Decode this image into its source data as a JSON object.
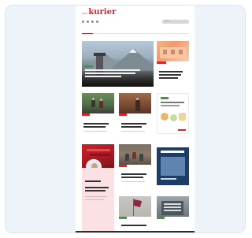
{
  "brand": {
    "small": "meine",
    "main": "kurier"
  },
  "colors": {
    "accent": "#d9232d",
    "frame": "#eef3fa",
    "tag_green": "#3f9a43",
    "tag_red": "#d9232d"
  },
  "utility": {
    "search_placeholder": "Suche"
  },
  "nav": [
    "",
    "",
    "",
    "",
    "",
    ""
  ],
  "hero": {
    "tag": "",
    "headline": "",
    "subline": ""
  },
  "icons": [
    "user-icon",
    "search-icon",
    "menu-icon",
    "share-icon"
  ],
  "footer": {
    "text": ""
  }
}
